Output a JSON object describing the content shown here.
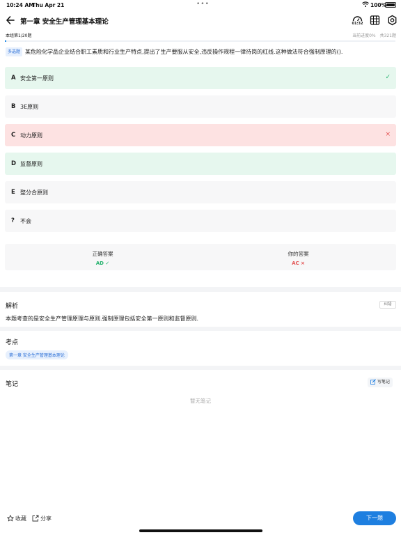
{
  "status_bar": {
    "time": "10:24 AM",
    "date": "Thu Apr 21",
    "battery": "100%"
  },
  "header": {
    "title": "第一章 安全生产管理基本理论",
    "timer": "01:32"
  },
  "subbar": {
    "group_progress": "本组第1/20题",
    "current_progress": "当前进度0%",
    "total": "共321题"
  },
  "progress_fraction": 0.004,
  "question": {
    "type": "多选题",
    "text": "某危险化学品企业结合职工素质和行业生产特点,提出了生产要服从安全,违反操作规程一律待岗的红线.这种做法符合强制原理的()."
  },
  "options": [
    {
      "letter": "A",
      "text": "安全第一原则",
      "state": "correct"
    },
    {
      "letter": "B",
      "text": "3E原则",
      "state": "normal"
    },
    {
      "letter": "C",
      "text": "动力原则",
      "state": "wrong"
    },
    {
      "letter": "D",
      "text": "监督原则",
      "state": "correct"
    },
    {
      "letter": "E",
      "text": "整分合原则",
      "state": "normal"
    },
    {
      "letter": "?",
      "text": "不会",
      "state": "normal"
    }
  ],
  "answers": {
    "correct_label": "正确答案",
    "correct_value": "AD ✓",
    "yours_label": "你的答案",
    "yours_value": "AC ×"
  },
  "analysis": {
    "title": "解析",
    "report": "纠错",
    "text": "本题考查的是安全生产管理原理与原则.强制原理包括安全第一原则和监督原则."
  },
  "points": {
    "title": "考点",
    "tag": "第一章 安全生产管理基本理论"
  },
  "notes": {
    "title": "笔记",
    "write": "写笔记",
    "empty": "暂无笔记"
  },
  "footer": {
    "favorite": "收藏",
    "share": "分享",
    "next": "下一题"
  },
  "colors": {
    "accent": "#1e7fe0",
    "correct": "#27b36f",
    "wrong": "#e35555"
  }
}
